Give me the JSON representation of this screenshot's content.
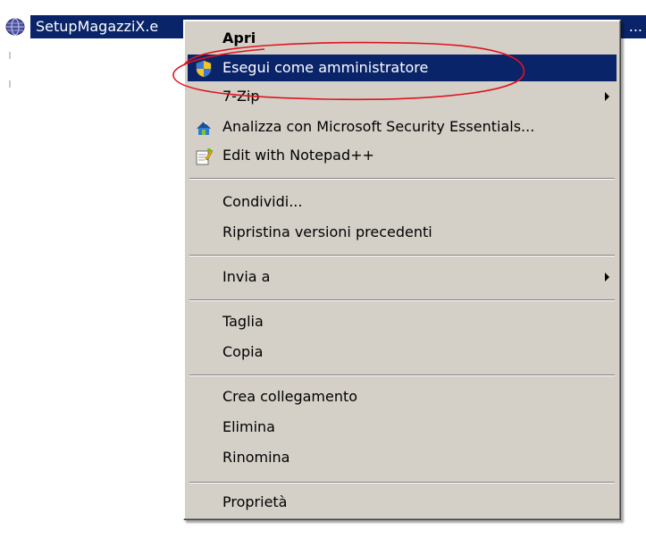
{
  "file": {
    "name": "SetupMagazziX.e",
    "ellipsis": "...",
    "icon": "setup-globe-icon",
    "highlight_color": "#0a246a"
  },
  "context_menu": {
    "items": [
      {
        "label": "Apri",
        "bold": true
      },
      {
        "label": "Esegui come amministratore",
        "icon": "uac-shield-icon",
        "selected": true
      },
      {
        "label": "7-Zip",
        "submenu": true
      },
      {
        "label": "Analizza con Microsoft Security Essentials...",
        "icon": "security-essentials-icon"
      },
      {
        "label": "Edit with Notepad++",
        "icon": "notepad-plus-plus-icon"
      },
      {
        "label": "Condividi..."
      },
      {
        "label": "Ripristina versioni precedenti"
      },
      {
        "label": "Invia a",
        "submenu": true
      },
      {
        "label": "Taglia"
      },
      {
        "label": "Copia"
      },
      {
        "label": "Crea collegamento"
      },
      {
        "label": "Elimina"
      },
      {
        "label": "Rinomina"
      },
      {
        "label": "Proprietà"
      }
    ],
    "menu_background": "#d4d0c8",
    "selection_color": "#0a246a"
  },
  "annotation": {
    "shape": "ellipse",
    "color": "#e0141e",
    "target": "Esegui come amministratore"
  }
}
